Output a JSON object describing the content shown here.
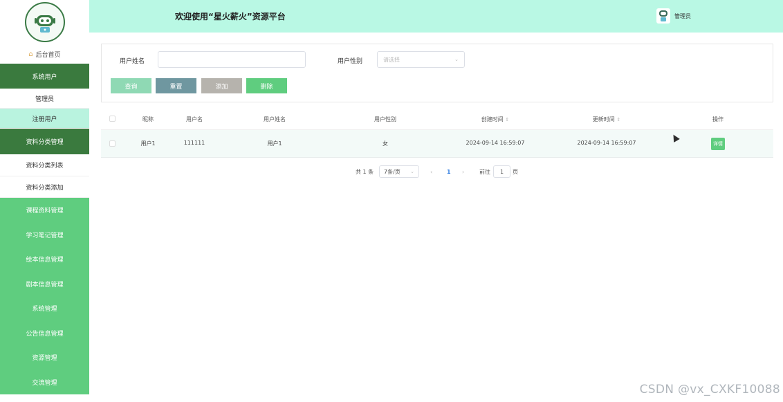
{
  "header": {
    "title": "欢迎使用“星火薪火”资源平台",
    "admin_label": "管理员",
    "bg_color": "#b9f8e4"
  },
  "sidebar": {
    "home_label": "后台首页",
    "groups": [
      {
        "label": "系统用户",
        "items": [
          "管理员",
          "注册用户"
        ],
        "active_item": "注册用户"
      },
      {
        "label": "资料分类管理",
        "items": [
          "资料分类列表",
          "资料分类添加"
        ]
      }
    ],
    "collapsed": [
      "课程资料管理",
      "学习笔记管理",
      "绘本信息管理",
      "剧本信息管理",
      "系统管理",
      "公告信息管理",
      "资源管理",
      "交流管理"
    ],
    "dark_color": "#3a7a3e",
    "light_color": "#5fcd7f",
    "active_color": "#b9f3df"
  },
  "search": {
    "name_label": "用户姓名",
    "name_value": "",
    "gender_label": "用户性别",
    "gender_placeholder": "请选择",
    "buttons": {
      "query": "查询",
      "reset": "重置",
      "add": "添加",
      "delete": "删除"
    },
    "button_colors": {
      "query": "#8fd9b4",
      "reset": "#6f97a0",
      "add": "#b6b3ad",
      "delete": "#5fcd7f"
    }
  },
  "table": {
    "columns": [
      "昵称",
      "用户名",
      "用户姓名",
      "用户性别",
      "创建时间",
      "更新时间",
      "操作"
    ],
    "rows": [
      {
        "nickname": "用户1",
        "username": "111111",
        "realname": "用户1",
        "gender": "女",
        "created": "2024-09-14 16:59:07",
        "updated": "2024-09-14 16:59:07",
        "action": "详情"
      }
    ]
  },
  "pagination": {
    "total": "共 1 条",
    "page_size": "7条/页",
    "prev": "‹",
    "current": "1",
    "next": "›",
    "goto_label": "前往",
    "goto_value": "1",
    "page_suffix": "页"
  },
  "watermark": "CSDN @vx_CXKF10088"
}
